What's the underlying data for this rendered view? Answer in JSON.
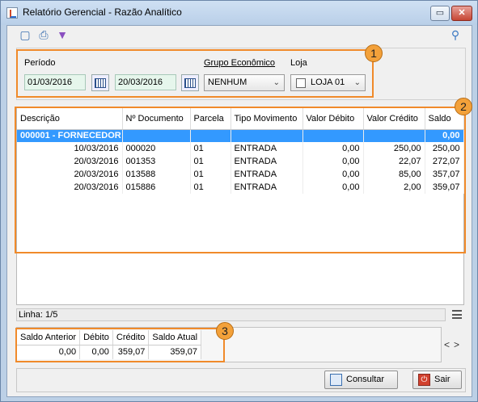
{
  "window": {
    "title": "Relatório Gerencial - Razão Analítico",
    "min_label": "▭",
    "close_label": "✕"
  },
  "filters": {
    "periodo_label": "Período",
    "date_from": "01/03/2016",
    "date_to": "20/03/2016",
    "grupo_label": "Grupo Econômico",
    "grupo_value": "NENHUM",
    "loja_label": "Loja",
    "loja_value": "LOJA 01"
  },
  "badges": {
    "one": "1",
    "two": "2",
    "three": "3"
  },
  "grid": {
    "columns": [
      "Descrição",
      "Nº Documento",
      "Parcela",
      "Tipo Movimento",
      "Valor Débito",
      "Valor Crédito",
      "Saldo"
    ],
    "group": {
      "descricao": "000001 - FORNECEDOR",
      "saldo": "0,00"
    },
    "rows": [
      {
        "data": "10/03/2016",
        "documento": "000020",
        "parcela": "01",
        "tipo": "ENTRADA",
        "debito": "0,00",
        "credito": "250,00",
        "saldo": "250,00"
      },
      {
        "data": "20/03/2016",
        "documento": "001353",
        "parcela": "01",
        "tipo": "ENTRADA",
        "debito": "0,00",
        "credito": "22,07",
        "saldo": "272,07"
      },
      {
        "data": "20/03/2016",
        "documento": "013588",
        "parcela": "01",
        "tipo": "ENTRADA",
        "debito": "0,00",
        "credito": "85,00",
        "saldo": "357,07"
      },
      {
        "data": "20/03/2016",
        "documento": "015886",
        "parcela": "01",
        "tipo": "ENTRADA",
        "debito": "0,00",
        "credito": "2,00",
        "saldo": "359,07"
      }
    ]
  },
  "status": {
    "linha": "Linha: 1/5"
  },
  "totals": {
    "headers": [
      "Saldo Anterior",
      "Débito",
      "Crédito",
      "Saldo Atual"
    ],
    "values": [
      "0,00",
      "0,00",
      "359,07",
      "359,07"
    ]
  },
  "nav": {
    "prev": "<",
    "next": ">"
  },
  "buttons": {
    "consultar": "Consultar",
    "sair": "Sair"
  },
  "icons": [
    "preview-icon",
    "print-icon",
    "filter-icon",
    "key-icon",
    "calendar-icon",
    "search-icon",
    "exit-icon"
  ],
  "colors": {
    "accent_orange": "#f08a2a",
    "selection_blue": "#3399ff",
    "field_green": "#e6f6ec"
  }
}
